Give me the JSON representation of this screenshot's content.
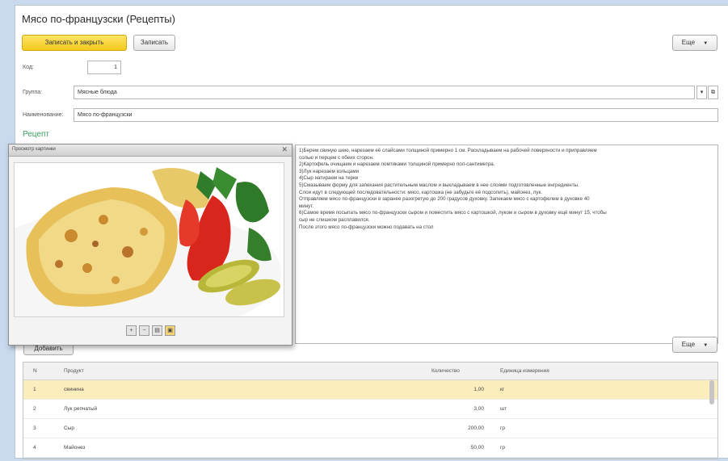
{
  "window": {
    "title": "Мясо по-французски (Рецепты)"
  },
  "toolbar": {
    "save_close_label": "Записать и закрыть",
    "save_label": "Записать",
    "more_label": "Еще"
  },
  "form": {
    "code_label": "Код:",
    "code_value": "1",
    "group_label": "Группа:",
    "group_value": "Мясные блюда",
    "name_label": "Наименование:",
    "name_value": "Мясо по-французски"
  },
  "recipe": {
    "section_title": "Рецепт",
    "lines": [
      "1)Берем свиную шею, нарезаем её слайсами толщиной примерно 1 см. Раскладываем на рабочей поверхности и приправляем",
      "солью и перцем с обеих сторон.",
      "2)Картофель очищаем и нарезаем ломтиками толщиной примерно пол-сантиметра.",
      "3)Лук нарезаем кольцами",
      "4)Сыр натираем на терке",
      "5)Смазываем форму для запекания растительным маслом и выкладываем в нее слоями подготовленные ингредиенты.",
      "Слои идут в следующей последовательности: мясо, картошка (не забудьте её подсолить), майонез, лук.",
      "Отправляем мясо по-французски в заранее разогретую до 200 градусов духовку. Запекаем мясо с картофелем в духовке 40",
      "минут.",
      "6)Самое время посыпать мясо по-французски сыром и поместить мясо с картошкой, луком и сыром в духовку ещё минут 15, чтобы",
      "сыр не слишком расплавился.",
      "После этого мясо по-французски можно подавать на стол"
    ]
  },
  "image_window": {
    "title": "Просмотр картинки"
  },
  "table": {
    "add_label": "Добавить",
    "more_label": "Еще",
    "headers": {
      "n": "N",
      "product": "Продукт",
      "qty": "Количество",
      "unit": "Единица измерения"
    },
    "rows": [
      {
        "n": "1",
        "product": "свинина",
        "qty": "1,00",
        "unit": "кг"
      },
      {
        "n": "2",
        "product": "Лук репчатый",
        "qty": "3,00",
        "unit": "шт"
      },
      {
        "n": "3",
        "product": "Сыр",
        "qty": "200,00",
        "unit": "гр"
      },
      {
        "n": "4",
        "product": "Майонез",
        "qty": "50,00",
        "unit": "гр"
      }
    ]
  },
  "colors": {
    "accent": "#f2c91d",
    "section": "#3a9a5b",
    "selected_row": "#fbeebc"
  },
  "icons": [
    "close-icon",
    "zoom-in-icon",
    "zoom-out-icon",
    "print-icon",
    "save-icon",
    "dropdown-icon",
    "open-icon"
  ]
}
